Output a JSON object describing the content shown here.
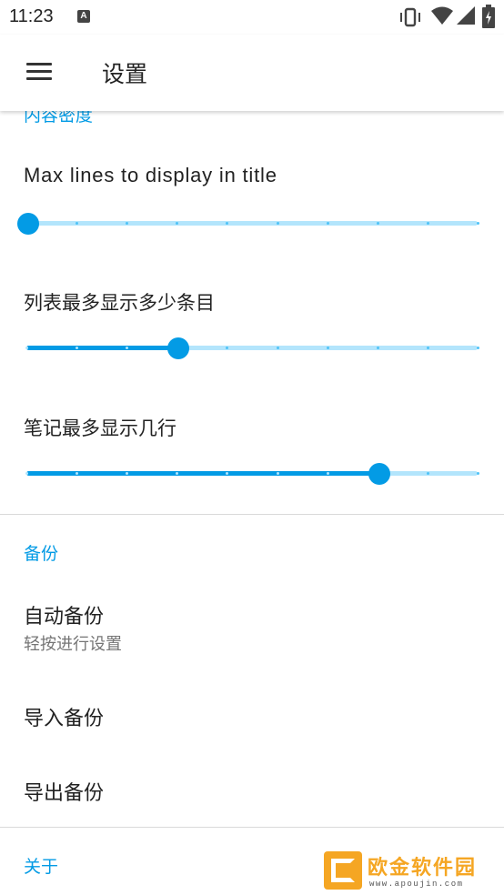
{
  "status_bar": {
    "time": "11:23",
    "notification_icon": "A"
  },
  "app_bar": {
    "title": "设置",
    "menu_icon": "hamburger-menu-icon"
  },
  "sections": {
    "density": {
      "header": "内容密度",
      "sliders": [
        {
          "label": "Max lines to display in title",
          "value_fraction": 0.0
        },
        {
          "label": "列表最多显示多少条目",
          "value_fraction": 0.333
        },
        {
          "label": "笔记最多显示几行",
          "value_fraction": 0.778
        }
      ]
    },
    "backup": {
      "header": "备份",
      "auto_backup": {
        "title": "自动备份",
        "summary": "轻按进行设置"
      },
      "import_backup": "导入备份",
      "export_backup": "导出备份"
    },
    "about": {
      "header": "关于"
    }
  },
  "watermark": {
    "text": "欧金软件园",
    "url": "www.apoujin.com"
  },
  "colors": {
    "accent": "#039be5",
    "track": "#b3e5fc"
  }
}
